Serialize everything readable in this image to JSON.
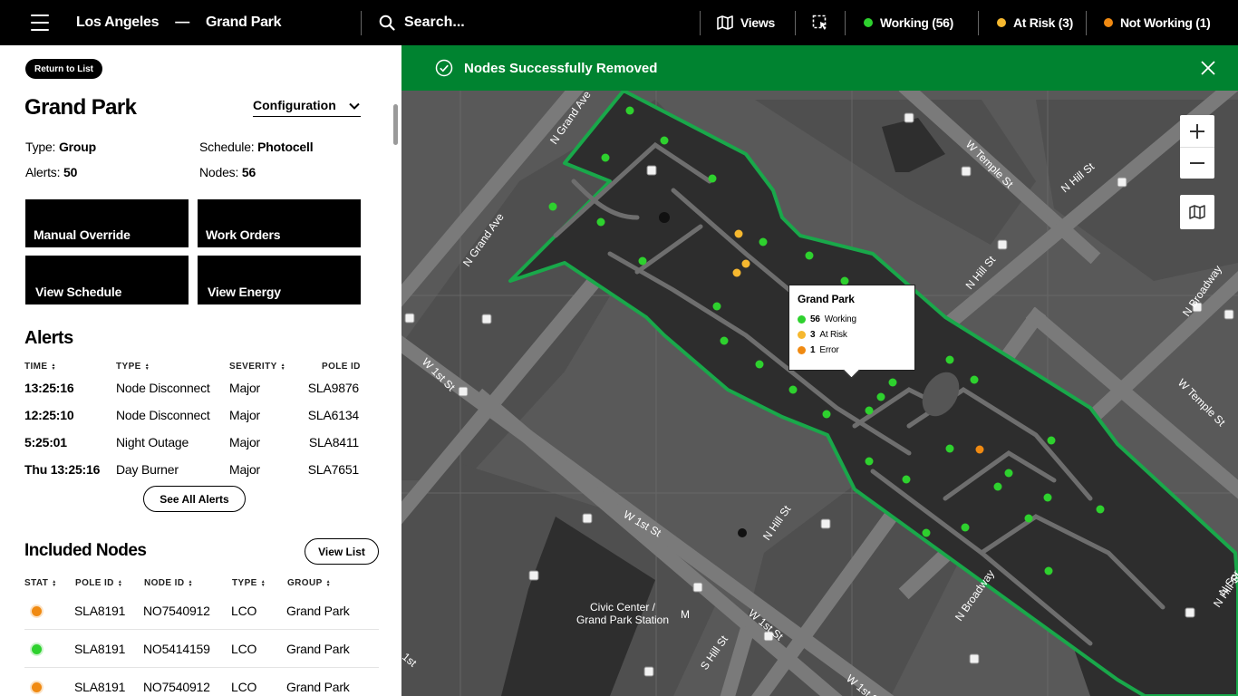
{
  "header": {
    "city": "Los Angeles",
    "separator": "—",
    "location": "Grand Park",
    "search_placeholder": "Search...",
    "views_label": "Views",
    "status": {
      "working": "Working (56)",
      "at_risk": "At Risk (3)",
      "not_working": "Not Working (1)"
    }
  },
  "colors": {
    "working": "#2ed12e",
    "at_risk": "#f6b82f",
    "not_working": "#f08a12",
    "banner": "#008330"
  },
  "panel": {
    "return_label": "Return to List",
    "title": "Grand Park",
    "config_label": "Configuration",
    "type_label": "Type:",
    "type_value": "Group",
    "schedule_label": "Schedule:",
    "schedule_value": "Photocell",
    "alerts_label": "Alerts:",
    "alerts_value": "50",
    "nodes_label": "Nodes:",
    "nodes_value": "56",
    "buttons": [
      "Manual Override",
      "Work Orders",
      "View Schedule",
      "View Energy"
    ]
  },
  "alerts": {
    "title": "Alerts",
    "columns": [
      "TIME",
      "TYPE",
      "SEVERITY",
      "POLE ID"
    ],
    "rows": [
      [
        "13:25:16",
        "Node Disconnect",
        "Major",
        "SLA9876"
      ],
      [
        "12:25:10",
        "Node Disconnect",
        "Major",
        "SLA6134"
      ],
      [
        "5:25:01",
        "Night Outage",
        "Major",
        "SLA8411"
      ],
      [
        "Thu 13:25:16",
        "Day Burner",
        "Major",
        "SLA7651"
      ]
    ],
    "see_all_label": "See All Alerts"
  },
  "nodes": {
    "title": "Included Nodes",
    "view_list_label": "View List",
    "columns": [
      "STAT",
      "POLE ID",
      "NODE ID",
      "TYPE",
      "GROUP"
    ],
    "rows": [
      {
        "stat": "not_working",
        "pole": "SLA8191",
        "node": "NO7540912",
        "type": "LCO",
        "group": "Grand Park"
      },
      {
        "stat": "working",
        "pole": "SLA8191",
        "node": "NO5414159",
        "type": "LCO",
        "group": "Grand Park"
      },
      {
        "stat": "not_working",
        "pole": "SLA8191",
        "node": "NO7540912",
        "type": "LCO",
        "group": "Grand Park"
      }
    ]
  },
  "map": {
    "banner_message": "Nodes Successfully Removed",
    "tooltip": {
      "title": "Grand Park",
      "working_count": "56",
      "working_label": "Working",
      "at_risk_count": "3",
      "at_risk_label": "At Risk",
      "error_count": "1",
      "error_label": "Error"
    },
    "street_labels": [
      "N Grand Ave",
      "N Grand Ave",
      "W Temple St",
      "N Hill St",
      "N Hill St",
      "W 1st St",
      "W 1st St",
      "N Broadway",
      "W Temple St",
      "N Hill St",
      "W 1st St",
      "S Hill St",
      "N Broadway",
      "W 1st St",
      "N Hill St",
      "Civic Center /",
      "Grand Park Station",
      "M",
      "1st",
      "N Spr",
      "W 1st St"
    ]
  }
}
